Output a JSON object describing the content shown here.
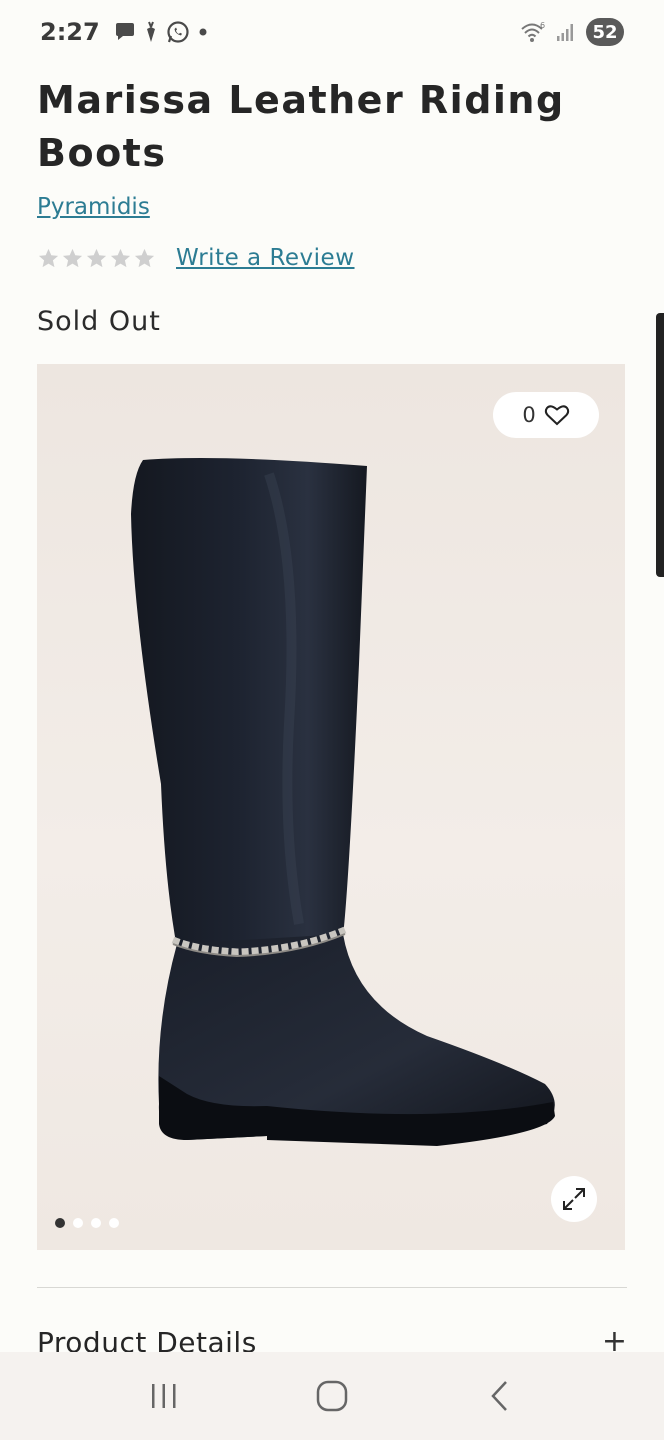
{
  "status": {
    "time": "2:27",
    "battery": "52",
    "network": "6"
  },
  "product": {
    "title": "Marissa Leather Riding Boots",
    "brand": "Pyramidis",
    "rating_stars": 0,
    "review_link": "Write a Review",
    "stock_status": "Sold Out",
    "wishlist_count": "0",
    "image_count": 4,
    "active_image": 1
  },
  "details": {
    "label": "Product Details",
    "expand_icon": "plus-icon"
  },
  "colors": {
    "link": "#2c7c93",
    "background": "#fcfcf9",
    "star_empty": "#cfcfcf"
  }
}
